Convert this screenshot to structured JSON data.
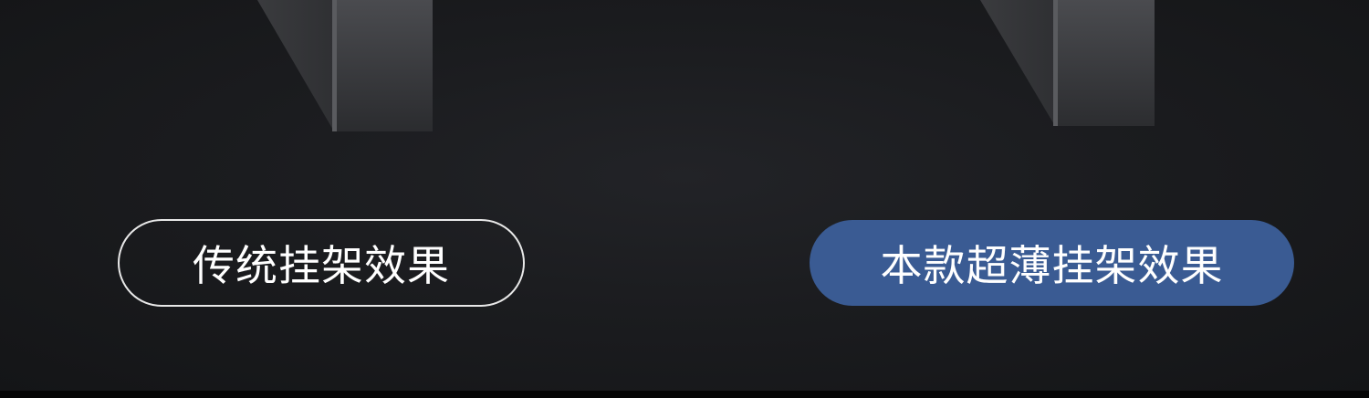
{
  "labels": {
    "traditional": "传统挂架效果",
    "ultrathin": "本款超薄挂架效果"
  },
  "colors": {
    "background": "#1b1c1f",
    "accent": "#3a5b93",
    "outline": "#e8e8e8"
  }
}
